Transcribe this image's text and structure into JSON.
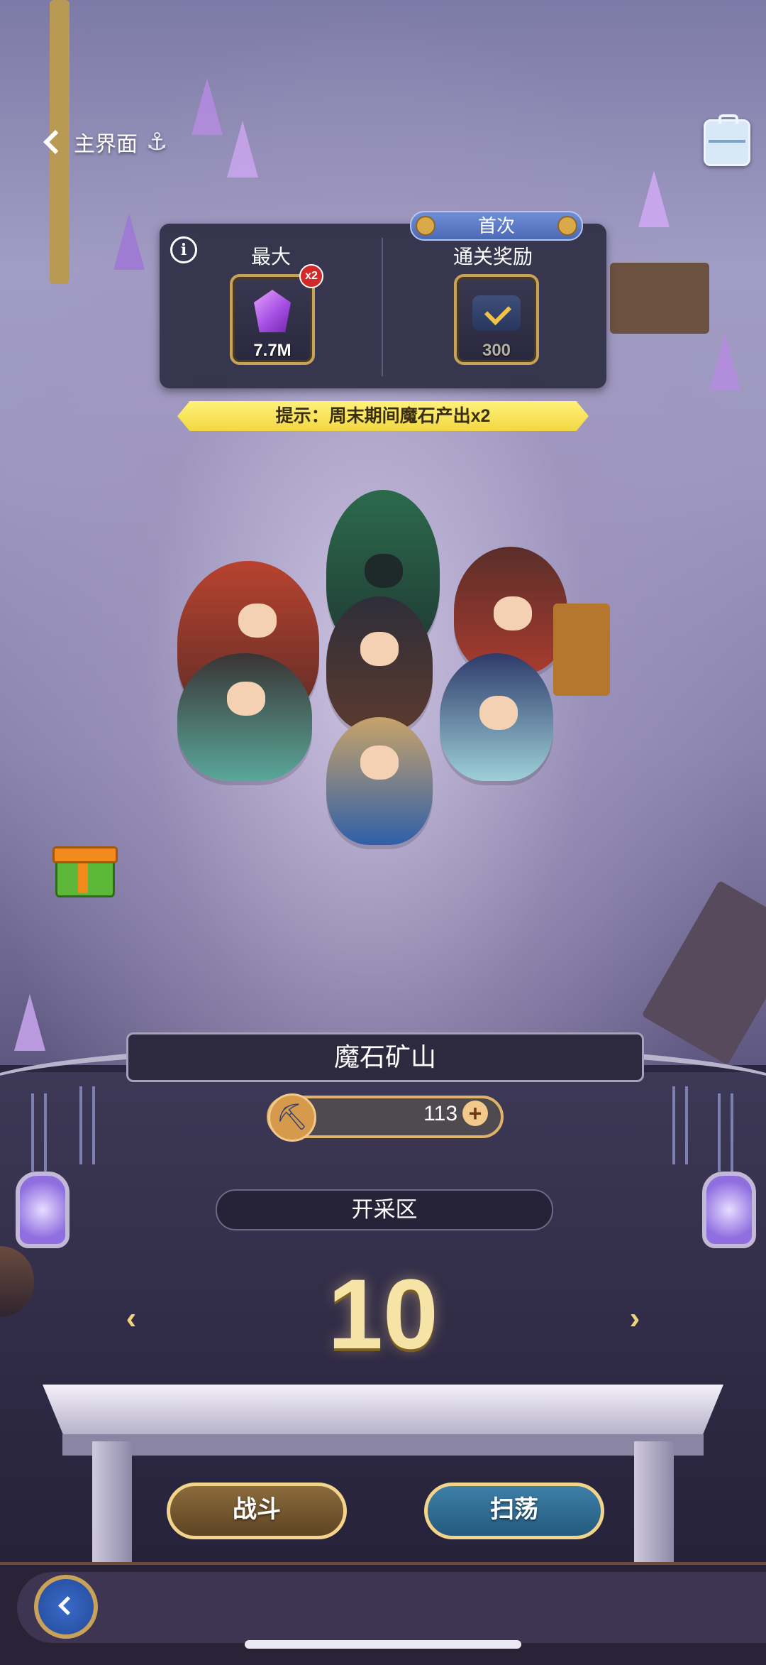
{
  "nav": {
    "back_label": "主界面",
    "anchor_icon": "anchor-icon",
    "toolbox_icon": "toolbox-icon"
  },
  "reward_panel": {
    "first_clear_tag": "首次",
    "max_label": "最大",
    "max_item": {
      "icon": "magic-stone-icon",
      "count": "7.7M",
      "multiplier": "x2"
    },
    "clear_reward_label": "通关奖励",
    "clear_item": {
      "icon": "chest-icon",
      "count": "300"
    }
  },
  "hint": "提示：周末期间魔石产出x2",
  "mine": {
    "title": "魔石矿山",
    "pickaxe_count": "113",
    "zone_label": "开采区",
    "stage_number": "10"
  },
  "buttons": {
    "fight": "战斗",
    "sweep": "扫荡"
  },
  "colors": {
    "gold": "#f2d48a",
    "panel": "#2d2a3f",
    "hint": "#f2d743"
  }
}
